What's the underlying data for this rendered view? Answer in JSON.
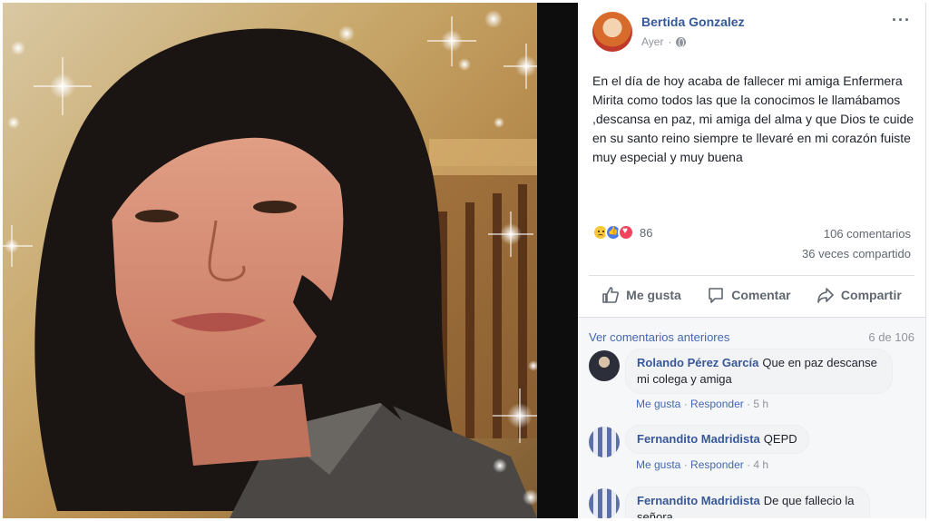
{
  "post": {
    "author": "Bertida Gonzalez",
    "time": "Ayer",
    "more_icon": "more-options-icon",
    "body": "En el día de hoy acaba de fallecer mi amiga Enfermera Mirita como todos las que la conocimos le llamábamos ,descansa en paz, mi amiga del alma y que Dios te cuide en su santo reino siempre te llevaré en mi corazón fuiste muy especial y muy buena",
    "reactions": [
      "sad",
      "like",
      "love"
    ],
    "reaction_count": "86",
    "comments_count": "106 comentarios",
    "shares_count": "36 veces compartido"
  },
  "actions": {
    "like": "Me gusta",
    "comment": "Comentar",
    "share": "Compartir"
  },
  "comments": {
    "previous_link": "Ver comentarios anteriores",
    "page_count": "6 de 106",
    "items": [
      {
        "name": "Rolando Pérez García",
        "text": "Que en paz descanse mi colega y amiga",
        "like": "Me gusta",
        "reply": "Responder",
        "time": "5 h"
      },
      {
        "name": "Fernandito Madridista",
        "text": "QEPD",
        "like": "Me gusta",
        "reply": "Responder",
        "time": "4 h"
      },
      {
        "name": "Fernandito Madridista",
        "text": "De que fallecio la señora",
        "like": "",
        "reply": "",
        "time": ""
      }
    ]
  },
  "colors": {
    "link": "#365899",
    "text": "#1d2129",
    "muted": "#90949c",
    "divider": "#0d0d0d"
  }
}
